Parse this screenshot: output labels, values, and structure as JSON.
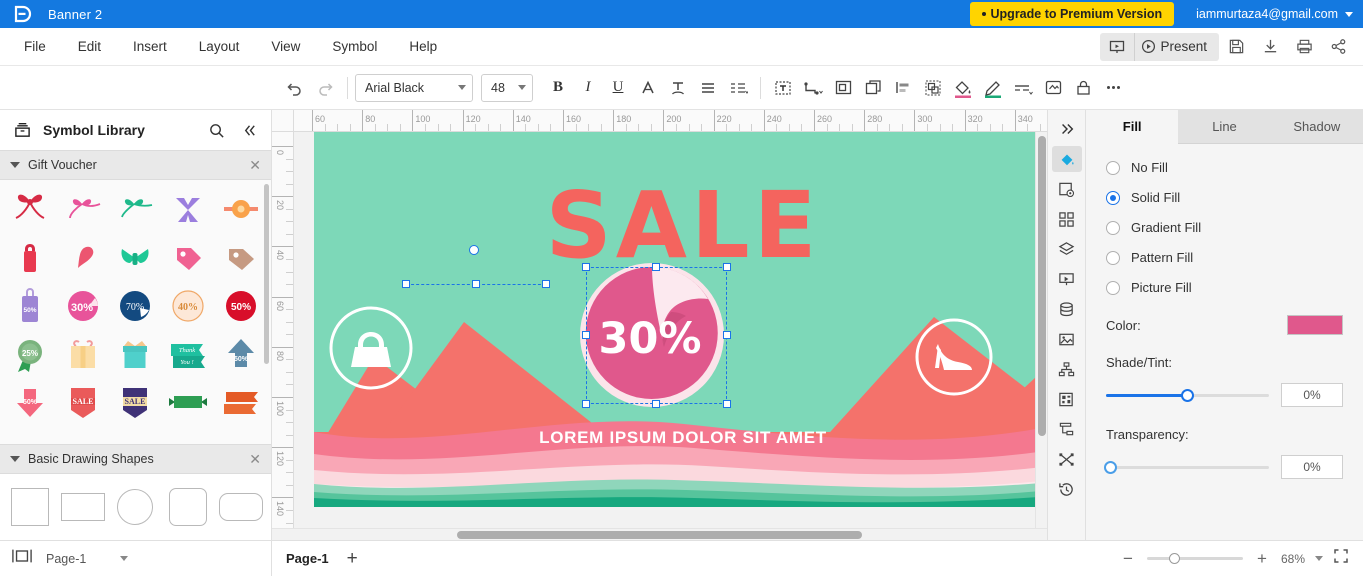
{
  "titlebar": {
    "doc_title": "Banner 2",
    "upgrade_label": "Upgrade to Premium Version",
    "account_email": "iammurtaza4@gmail.com",
    "brand_color": "#1479e0",
    "upgrade_color": "#ffd400"
  },
  "menubar": {
    "items": [
      {
        "label": "File"
      },
      {
        "label": "Edit"
      },
      {
        "label": "Insert"
      },
      {
        "label": "Layout"
      },
      {
        "label": "View"
      },
      {
        "label": "Symbol"
      },
      {
        "label": "Help"
      }
    ],
    "present_label": "Present"
  },
  "toolbar": {
    "font_family": "Arial Black",
    "font_size": "48",
    "fill_accent": "#e0588c"
  },
  "sidebar": {
    "title": "Symbol Library",
    "sections": [
      {
        "name": "Gift Voucher"
      },
      {
        "name": "Basic Drawing Shapes"
      }
    ],
    "symbol_badges": [
      "50%",
      "30%",
      "70%",
      "40%",
      "50%",
      "25%",
      "50%",
      "50%"
    ],
    "symbol_labels": [
      "Thank",
      "You !",
      "SALE",
      "SALE"
    ]
  },
  "pagebar": {
    "page_select": "Page-1",
    "page_tab": "Page-1",
    "add_label": "+",
    "zoom_value": "68%"
  },
  "rulers": {
    "horizontal": [
      60,
      80,
      100,
      120,
      140,
      160,
      180,
      200,
      220,
      240,
      260,
      280,
      300,
      320,
      340
    ],
    "vertical": [
      0,
      20,
      40,
      60,
      80,
      100,
      120,
      140
    ]
  },
  "canvas": {
    "headline": "SALE",
    "badge_text": "30%",
    "footer_text": "LOREM IPSUM DOLOR SIT AMET",
    "mint": "#7dd8b8",
    "coral": "#f4645e",
    "pink": "#e0588c",
    "blush": "#fbd9de"
  },
  "right_panel": {
    "tabs": [
      {
        "label": "Fill",
        "active": true
      },
      {
        "label": "Line",
        "active": false
      },
      {
        "label": "Shadow",
        "active": false
      }
    ],
    "fill_options": [
      {
        "label": "No Fill",
        "selected": false
      },
      {
        "label": "Solid Fill",
        "selected": true
      },
      {
        "label": "Gradient Fill",
        "selected": false
      },
      {
        "label": "Pattern Fill",
        "selected": false
      },
      {
        "label": "Picture Fill",
        "selected": false
      }
    ],
    "color_label": "Color:",
    "color_value": "#e0588c",
    "shade_label": "Shade/Tint:",
    "shade_value": "0%",
    "transparency_label": "Transparency:",
    "transparency_value": "0%"
  }
}
